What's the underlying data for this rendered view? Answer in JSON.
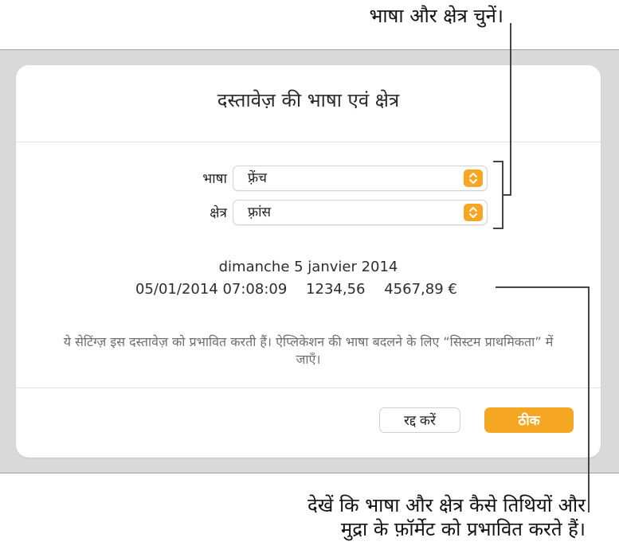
{
  "callouts": {
    "top": "भाषा और क्षेत्र चुनें।",
    "bottom_line1": "देखें कि भाषा और क्षेत्र कैसे तिथियों और",
    "bottom_line2": "मुद्रा के फ़ॉर्मेट को प्रभावित करते हैं।"
  },
  "dialog": {
    "title": "दस्तावेज़ की भाषा एवं क्षेत्र",
    "language": {
      "label": "भाषा :",
      "value": "फ़्रेंच",
      "icon": "stepper-chevrons-icon"
    },
    "region": {
      "label": "क्षेत्र :",
      "value": "फ़्रांस",
      "icon": "stepper-chevrons-icon"
    },
    "preview": {
      "date_long": "dimanche 5 janvier 2014",
      "date_time": "05/01/2014 07:08:09",
      "number": "1234,56",
      "currency": "4567,89 €"
    },
    "info": "ये सेटिंग्ज़ इस दस्तावेज़ को प्रभावित करती हैं। ऐप्लिकेशन की भाषा बदलने के लिए “सिस्टम प्राथमिकता” में जाएँ।",
    "buttons": {
      "cancel": "रद्द करें",
      "ok": "ठीक"
    }
  },
  "colors": {
    "accent": "#f5a623",
    "backdrop": "#d9d9d9",
    "dialog_bg": "#ffffff",
    "muted_text": "#6e6e6e"
  }
}
